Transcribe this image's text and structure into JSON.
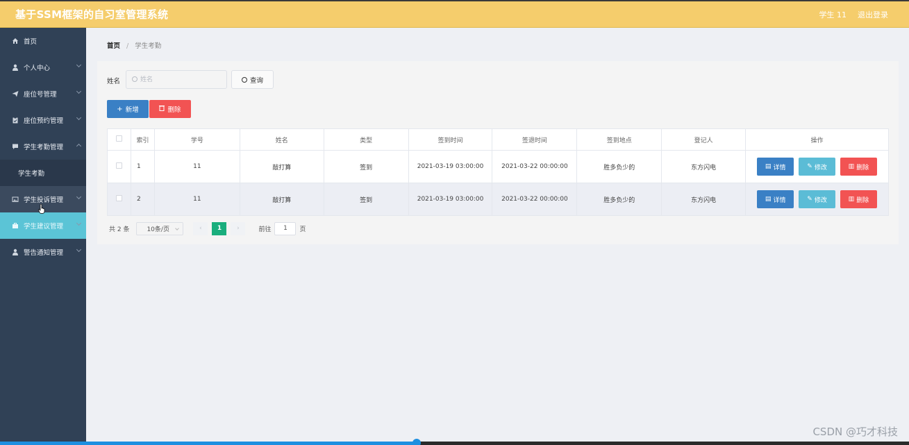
{
  "header": {
    "title": "基于SSM框架的自习室管理系统",
    "user": "学生 11",
    "logout": "退出登录"
  },
  "sidebar": {
    "items": [
      {
        "label": "首页",
        "icon": "home-icon"
      },
      {
        "label": "个人中心",
        "icon": "user-icon"
      },
      {
        "label": "座位号管理",
        "icon": "send-icon"
      },
      {
        "label": "座位预约管理",
        "icon": "clipboard-icon"
      },
      {
        "label": "学生考勤管理",
        "icon": "chat-icon"
      },
      {
        "label": "学生考勤",
        "icon": ""
      },
      {
        "label": "学生投诉管理",
        "icon": "picture-icon"
      },
      {
        "label": "学生建议管理",
        "icon": "briefcase-icon"
      },
      {
        "label": "警告通知管理",
        "icon": "user-icon"
      }
    ]
  },
  "breadcrumb": {
    "home": "首页",
    "separator": "/",
    "current": "学生考勤"
  },
  "search": {
    "label": "姓名",
    "placeholder": "姓名",
    "button": "查询"
  },
  "actions": {
    "add": "新增",
    "delete": "删除"
  },
  "table": {
    "headers": [
      "索引",
      "学号",
      "姓名",
      "类型",
      "签到时间",
      "签退时间",
      "签到地点",
      "登记人",
      "操作"
    ],
    "rows": [
      [
        "1",
        "11",
        "敲打算",
        "签到",
        "2021-03-19 03:00:00",
        "2021-03-22 00:00:00",
        "胜多负少的",
        "东方闪电"
      ],
      [
        "2",
        "11",
        "敲打算",
        "签到",
        "2021-03-19 03:00:00",
        "2021-03-22 00:00:00",
        "胜多负少的",
        "东方闪电"
      ]
    ],
    "ops": {
      "detail": "详情",
      "edit": "修改",
      "delete": "删除"
    }
  },
  "pagination": {
    "total": "共 2 条",
    "page_size": "10条/页",
    "prev": "‹",
    "next": "›",
    "current_page": "1",
    "goto_label": "前往",
    "goto_value": "1",
    "goto_suffix": "页"
  },
  "watermark": "CSDN @巧才科技",
  "colors": {
    "header": "#f5cd6c",
    "sidebar": "#304156",
    "active_menu": "#5bc4d6",
    "primary": "#3a80c5",
    "danger": "#f25353",
    "info": "#5bbcd6",
    "page_active": "#1aae7d"
  }
}
